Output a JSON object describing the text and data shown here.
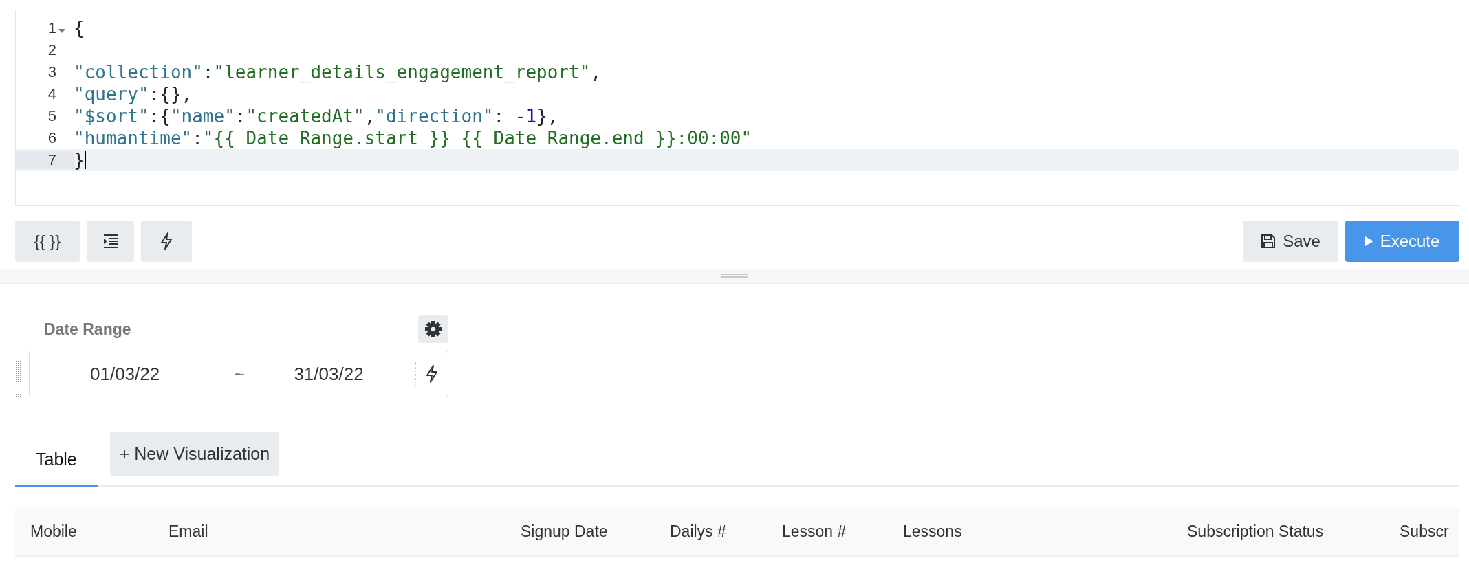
{
  "editor": {
    "lines": [
      {
        "number": "1",
        "active": false,
        "foldable": true,
        "tokens": [
          {
            "kind": "punct",
            "text": "{"
          }
        ]
      },
      {
        "number": "2",
        "active": false,
        "foldable": false
      },
      {
        "number": "3",
        "active": false,
        "foldable": false,
        "tokens": [
          {
            "kind": "key",
            "text": "\"collection\""
          },
          {
            "kind": "punct",
            "text": ":"
          },
          {
            "kind": "string",
            "text": "\"learner_details_engagement_report\""
          },
          {
            "kind": "punct",
            "text": ","
          }
        ]
      },
      {
        "number": "4",
        "active": false,
        "foldable": false,
        "tokens": [
          {
            "kind": "key",
            "text": "\"query\""
          },
          {
            "kind": "punct",
            "text": ":{},"
          }
        ]
      },
      {
        "number": "5",
        "active": false,
        "foldable": false,
        "tokens": [
          {
            "kind": "key",
            "text": "\"$sort\""
          },
          {
            "kind": "punct",
            "text": ":{"
          },
          {
            "kind": "key",
            "text": "\"name\""
          },
          {
            "kind": "punct",
            "text": ":"
          },
          {
            "kind": "string",
            "text": "\"createdAt\""
          },
          {
            "kind": "punct",
            "text": ","
          },
          {
            "kind": "key",
            "text": "\"direction\""
          },
          {
            "kind": "punct",
            "text": ": "
          },
          {
            "kind": "number",
            "text": "-1"
          },
          {
            "kind": "punct",
            "text": "},"
          }
        ]
      },
      {
        "number": "6",
        "active": false,
        "foldable": false,
        "tokens": [
          {
            "kind": "key",
            "text": "\"humantime\""
          },
          {
            "kind": "punct",
            "text": ":"
          },
          {
            "kind": "string",
            "text": "\"{{ Date Range.start }} {{ Date Range.end }}:00:00\""
          }
        ]
      },
      {
        "number": "7",
        "active": true,
        "foldable": false,
        "tokens": [
          {
            "kind": "punct",
            "text": "}"
          }
        ]
      }
    ]
  },
  "toolbar": {
    "left": [
      {
        "kind": "text",
        "label": "{{ }}"
      },
      {
        "kind": "indent"
      },
      {
        "kind": "bolt"
      }
    ],
    "save": {
      "label": "Save"
    },
    "execute": {
      "label": "Execute"
    }
  },
  "parameter": {
    "label": "Date Range",
    "start": "01/03/22",
    "separator": "~",
    "end": "31/03/22"
  },
  "tabs": [
    {
      "label": "Table",
      "selected": true
    }
  ],
  "new_visualization": {
    "label": "+ New Visualization"
  },
  "table": {
    "columns": [
      "Mobile",
      "Email",
      "Signup Date",
      "Dailys #",
      "Lesson #",
      "Lessons",
      "Subscription Status",
      "Subscr"
    ]
  }
}
